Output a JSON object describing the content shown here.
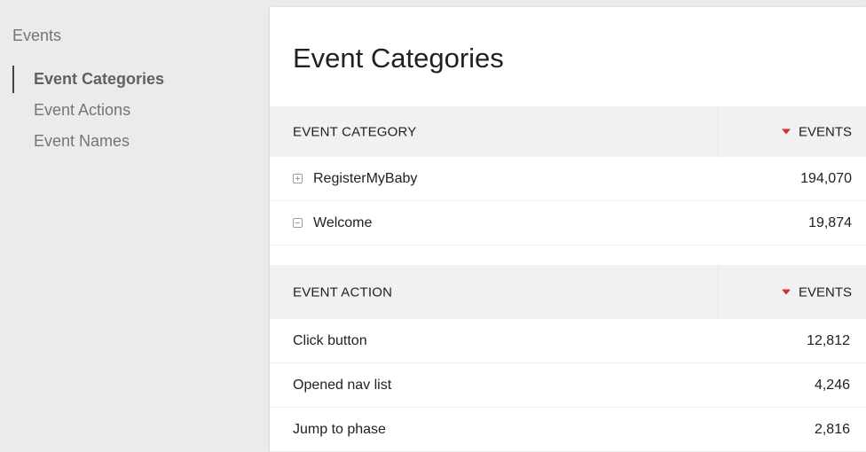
{
  "sidebar": {
    "title": "Events",
    "items": [
      {
        "label": "Event Categories",
        "active": true
      },
      {
        "label": "Event Actions",
        "active": false
      },
      {
        "label": "Event Names",
        "active": false
      }
    ]
  },
  "main": {
    "title": "Event Categories",
    "category_table": {
      "header_label": "EVENT CATEGORY",
      "header_metric": "EVENTS",
      "rows": [
        {
          "label": "RegisterMyBaby",
          "value": "194,070",
          "expander": "plus"
        },
        {
          "label": "Welcome",
          "value": "19,874",
          "expander": "minus"
        }
      ]
    },
    "action_table": {
      "header_label": "EVENT ACTION",
      "header_metric": "EVENTS",
      "rows": [
        {
          "label": "Click button",
          "value": "12,812"
        },
        {
          "label": "Opened nav list",
          "value": "4,246"
        },
        {
          "label": "Jump to phase",
          "value": "2,816"
        }
      ]
    }
  },
  "colors": {
    "sort_arrow": "#d32f2f",
    "active_indicator": "#424242"
  }
}
